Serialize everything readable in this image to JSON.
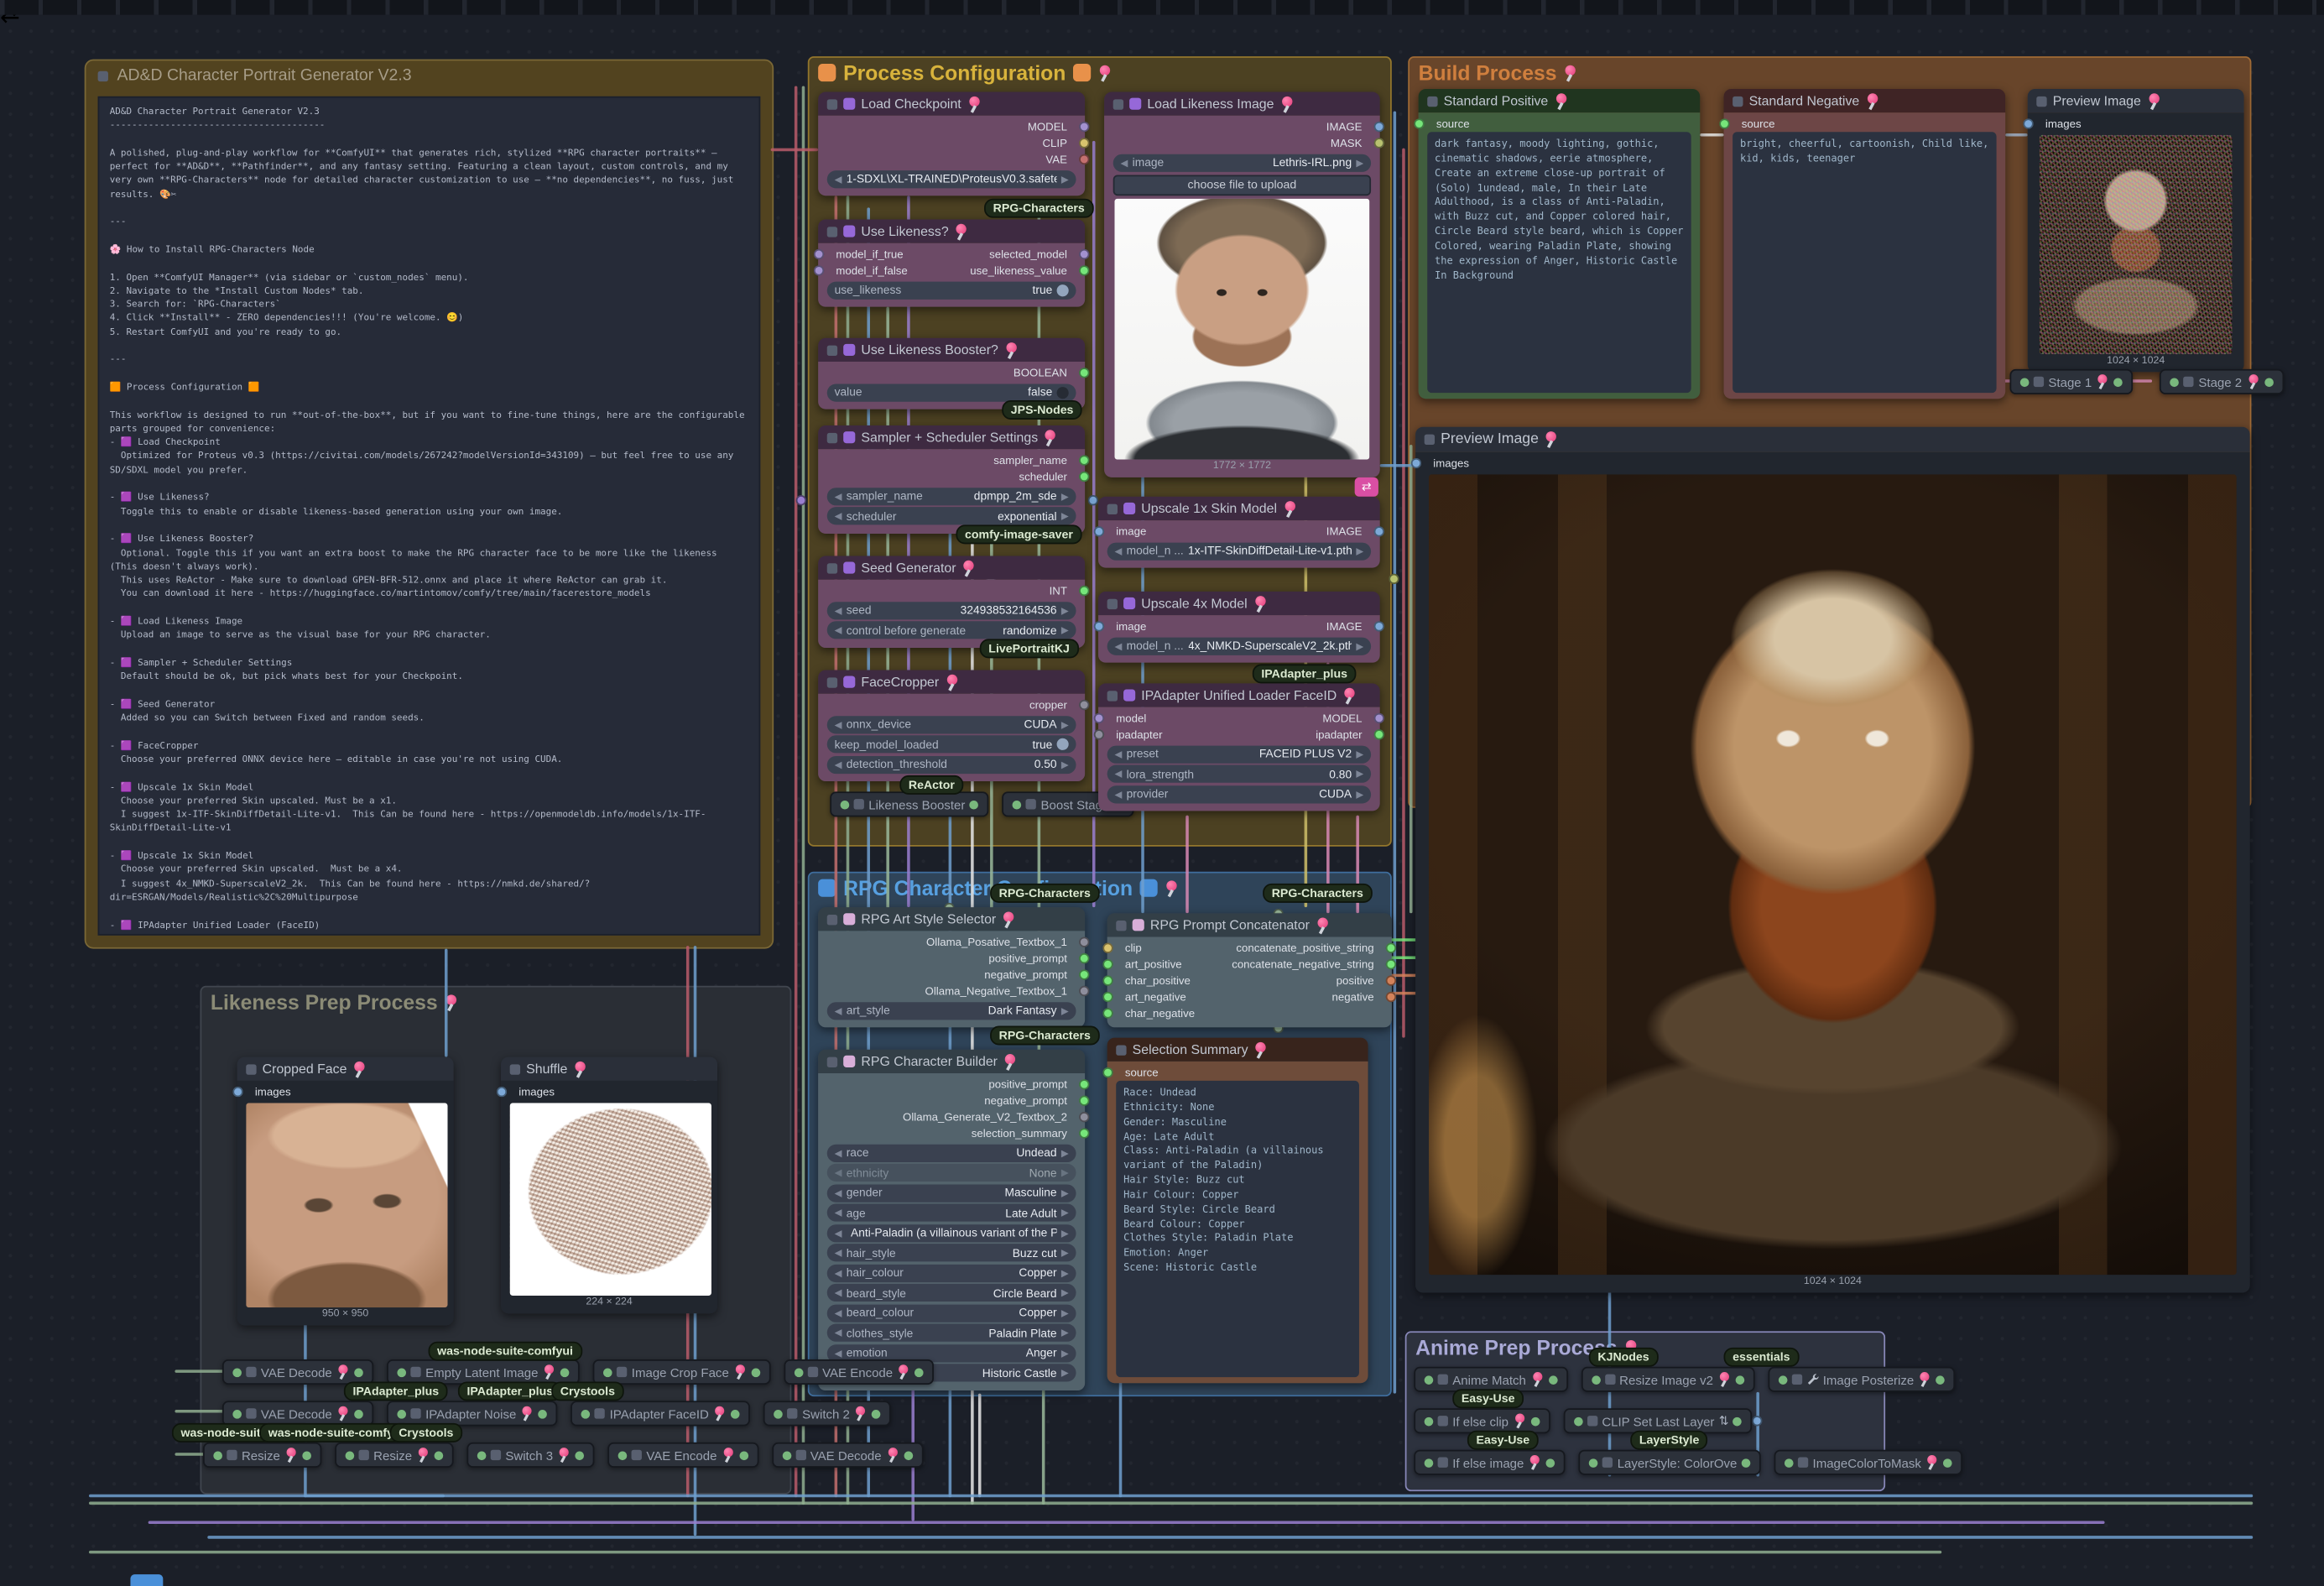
{
  "note": {
    "title": "AD&D Character Portrait Generator V2.3",
    "body": "AD&D Character Portrait Generator V2.3\n---------------------------------------\n\nA polished, plug-and-play workflow for **ComfyUI** that generates rich, stylized **RPG character portraits** — perfect for **AD&D**, **Pathfinder**, and any fantasy setting. Featuring a clean layout, custom controls, and my very own **RPG-Characters** node for detailed character customization to use — **no dependencies**, no fuss, just results. 🎨✂\n\n---\n\n🌸 How to Install RPG-Characters Node\n\n1. Open **ComfyUI Manager** (via sidebar or `custom_nodes` menu).\n2. Navigate to the *Install Custom Nodes* tab.\n3. Search for: `RPG-Characters`\n4. Click **Install** - ZERO dependencies!!! (You're welcome. 😊)\n5. Restart ComfyUI and you're ready to go.\n\n---\n\n🟧 Process Configuration 🟧\n\nThis workflow is designed to run **out-of-the-box**, but if you want to fine-tune things, here are the configurable parts grouped for convenience:\n- 🟪 Load Checkpoint\n  Optimized for Proteus v0.3 (https://civitai.com/models/267242?modelVersionId=343109) — but feel free to use any SD/SDXL model you prefer.\n\n- 🟪 Use Likeness?\n  Toggle this to enable or disable likeness-based generation using your own image.\n\n- 🟪 Use Likeness Booster?\n  Optional. Toggle this if you want an extra boost to make the RPG character face to be more like the likeness (This doesn't always work).\n  This uses ReActor - Make sure to download GPEN-BFR-512.onnx and place it where ReActor can grab it.\n  You can download it here - https://huggingface.co/martintomov/comfy/tree/main/facerestore_models\n\n- 🟪 Load Likeness Image\n  Upload an image to serve as the visual base for your RPG character.\n\n- 🟪 Sampler + Scheduler Settings\n  Default should be ok, but pick whats best for your Checkpoint.\n\n- 🟪 Seed Generator\n  Added so you can Switch between Fixed and random seeds.\n\n- 🟪 FaceCropper\n  Choose your preferred ONNX device here — editable in case you're not using CUDA.\n\n- 🟪 Upscale 1x Skin Model\n  Choose your preferred Skin upscaled. Must be a x1.\n  I suggest 1x-ITF-SkinDiffDetail-Lite-v1.  This Can be found here - https://openmodeldb.info/models/1x-ITF-SkinDiffDetail-Lite-v1\n\n- 🟪 Upscale 1x Skin Model\n  Choose your preferred Skin upscaled.  Must be a x4.\n  I suggest 4x_NMKD-SuperscaleV2_2k.  This Can be found here - https://nmkd.de/shared/?dir=ESRGAN/Models/Realistic%2C%20Multipurpose\n\n- 🟪 IPAdapter Unified Loader (FaceID)\n  Also editable so you can select your preferred backend provider.\n\n---\n\n🟦 RPG Character Configuration 🟦\n\nThis is where the *magic* happens — powered by **custom RPG nodes** made specifically for immersive character creation.\n\n- 🟪 RPG Art Style Selector\n  Pick the art style you want for your character: Anime, Realistic, Dark Fantasy, etc.\n\n- 🟪 RPG Character Builder\n  Customize Race, Gender, Age, Class, Hair, Clothing, Emotion, Scene, and more.\n\n---\n\n🚀 That's It!\n\nOnce you've tweaked your inputs (or left them at default), **just run the workflow** and enjoy your character portrait.\n\nHappy questing! 🎲🛡"
  },
  "badges": {
    "rpg": "RPG-Characters",
    "jps": "JPS-Nodes",
    "cis": "comfy-image-saver",
    "lp": "LivePortraitKJ",
    "reactor": "ReActor",
    "ipa": "IPAdapter_plus",
    "was": "was-node-suite-comfyui",
    "was_cut": "was-node-suite-comfy",
    "crys": "Crystools",
    "kj": "KJNodes",
    "ess": "essentials",
    "easy": "Easy-Use",
    "layer": "LayerStyle"
  },
  "process": {
    "title": "Process Configuration",
    "load_checkpoint": {
      "title": "Load Checkpoint",
      "outputs": [
        {
          "label": "MODEL",
          "color": "#a291cf"
        },
        {
          "label": "CLIP",
          "color": "#d9c36e"
        },
        {
          "label": "VAE",
          "color": "#c4706f"
        }
      ],
      "widget": {
        "value": "1-SDXL\\XL-TRAINED\\ProteusV0.3.safete ..."
      }
    },
    "use_likeness": {
      "title": "Use Likeness?",
      "inputs": [
        {
          "label": "model_if_true",
          "color": "#a291cf"
        },
        {
          "label": "model_if_false",
          "color": "#a291cf"
        }
      ],
      "outputs": [
        {
          "label": "selected_model",
          "color": "#a291cf"
        },
        {
          "label": "use_likeness_value",
          "color": "#76e67a"
        }
      ],
      "toggle": {
        "label": "use_likeness",
        "value": "true"
      }
    },
    "booster": {
      "title": "Use Likeness Booster?",
      "outputs": [
        {
          "label": "BOOLEAN",
          "color": "#76e67a"
        }
      ],
      "toggle": {
        "label": "value",
        "value": "false"
      }
    },
    "sampler": {
      "title": "Sampler + Scheduler Settings",
      "outputs": [
        {
          "label": "sampler_name",
          "color": "#76e67a"
        },
        {
          "label": "scheduler",
          "color": "#76e67a"
        }
      ],
      "widgets": [
        {
          "label": "sampler_name",
          "value": "dpmpp_2m_sde",
          "type": "combo"
        },
        {
          "label": "scheduler",
          "value": "exponential",
          "type": "combo"
        }
      ]
    },
    "seed": {
      "title": "Seed Generator",
      "outputs": [
        {
          "label": "INT",
          "color": "#76e67a"
        }
      ],
      "widgets": [
        {
          "label": "seed",
          "value": "324938532164536",
          "type": "combo"
        },
        {
          "label": "control before generate",
          "value": "randomize",
          "type": "combo"
        }
      ]
    },
    "facecropper": {
      "title": "FaceCropper",
      "outputs": [
        {
          "label": "cropper",
          "color": "#8e8e9c"
        }
      ],
      "widgets": [
        {
          "label": "onnx_device",
          "value": "CUDA",
          "type": "combo"
        },
        {
          "label": "keep_model_loaded",
          "value": "true",
          "type": "toggle-on"
        },
        {
          "label": "detection_threshold",
          "value": "0.50",
          "type": "combo"
        }
      ]
    },
    "collapsed": [
      {
        "label": "Likeness Booster"
      },
      {
        "label": "Boost Stage"
      }
    ],
    "load_image": {
      "title": "Load Likeness Image",
      "outputs": [
        {
          "label": "IMAGE",
          "color": "#7da9d8"
        },
        {
          "label": "MASK",
          "color": "#b9c270"
        }
      ],
      "widget": {
        "label": "image",
        "value": "Lethris-IRL.png"
      },
      "button": "choose file to upload",
      "caption": "1772 × 1772"
    },
    "upscale1": {
      "title": "Upscale 1x Skin Model",
      "inputs": [
        {
          "label": "image",
          "color": "#7da9d8"
        }
      ],
      "outputs": [
        {
          "label": "IMAGE",
          "color": "#7da9d8"
        }
      ],
      "widget": {
        "label": "model_n ...",
        "value": "1x-ITF-SkinDiffDetail-Lite-v1.pth"
      }
    },
    "upscale4": {
      "title": "Upscale 4x Model",
      "inputs": [
        {
          "label": "image",
          "color": "#7da9d8"
        }
      ],
      "outputs": [
        {
          "label": "IMAGE",
          "color": "#7da9d8"
        }
      ],
      "widget": {
        "label": "model_n ...",
        "value": "4x_NMKD-SuperscaleV2_2k.pth"
      }
    },
    "ipadapter": {
      "title": "IPAdapter Unified Loader FaceID",
      "inputs": [
        {
          "label": "model",
          "color": "#a291cf"
        },
        {
          "label": "ipadapter",
          "color": "#8e8e9c"
        }
      ],
      "outputs": [
        {
          "label": "MODEL",
          "color": "#a291cf"
        },
        {
          "label": "ipadapter",
          "color": "#76e67a"
        }
      ],
      "widgets": [
        {
          "label": "preset",
          "value": "FACEID PLUS V2",
          "type": "combo"
        },
        {
          "label": "lora_strength",
          "value": "0.80",
          "type": "combo"
        },
        {
          "label": "provider",
          "value": "CUDA",
          "type": "combo"
        }
      ]
    }
  },
  "build": {
    "title": "Build Process",
    "positive": {
      "title": "Standard Positive",
      "port": "source",
      "port_color": "#76e67a",
      "text": "dark fantasy, moody lighting, gothic, cinematic shadows, eerie atmosphere, Create an extreme close-up portrait of (Solo) 1undead, male, In their Late Adulthood, is a class of Anti-Paladin, with Buzz cut, and Copper colored hair, Circle Beard style beard, which is Copper Colored, wearing Paladin Plate, showing the expression of Anger, Historic Castle In Background"
    },
    "negative": {
      "title": "Standard Negative",
      "port": "source",
      "port_color": "#76e67a",
      "text": "bright, cheerful, cartoonish, Child like, kid, kids, teenager"
    },
    "preview_small": {
      "title": "Preview Image",
      "port": "images",
      "port_color": "#7da9d8",
      "caption": "1024 × 1024"
    },
    "stages": [
      {
        "label": "Stage 1",
        "cls": "haspin"
      },
      {
        "label": "Stage 2",
        "cls": "haspin"
      }
    ]
  },
  "preview_big": {
    "title": "Preview Image",
    "port": "images",
    "port_color": "#7da9d8",
    "caption": "1024 × 1024"
  },
  "rpg": {
    "title": "RPG Character Configuration",
    "art_selector": {
      "title": "RPG Art Style Selector",
      "outputs": [
        {
          "label": "Ollama_Posative_Textbox_1",
          "color": "#8e8e9c"
        },
        {
          "label": "positive_prompt",
          "color": "#76e67a"
        },
        {
          "label": "negative_prompt",
          "color": "#76e67a"
        },
        {
          "label": "Ollama_Negative_Textbox_1",
          "color": "#8e8e9c"
        }
      ],
      "widget": {
        "label": "art_style",
        "value": "Dark Fantasy"
      }
    },
    "builder": {
      "title": "RPG Character Builder",
      "outputs": [
        {
          "label": "positive_prompt",
          "color": "#76e67a"
        },
        {
          "label": "negative_prompt",
          "color": "#76e67a"
        },
        {
          "label": "Ollama_Generate_V2_Textbox_2",
          "color": "#8e8e9c"
        },
        {
          "label": "selection_summary",
          "color": "#76e67a"
        }
      ],
      "widgets": [
        {
          "label": "race",
          "value": "Undead",
          "type": "combo"
        },
        {
          "label": "ethnicity",
          "value": "None",
          "type": "combo dim"
        },
        {
          "label": "gender",
          "value": "Masculine",
          "type": "combo"
        },
        {
          "label": "age",
          "value": "Late Adult",
          "type": "combo"
        },
        {
          "label": "",
          "value": "Anti-Paladin (a villainous variant of the Pala ...",
          "type": "combo long"
        },
        {
          "label": "hair_style",
          "value": "Buzz cut",
          "type": "combo"
        },
        {
          "label": "hair_colour",
          "value": "Copper",
          "type": "combo"
        },
        {
          "label": "beard_style",
          "value": "Circle Beard",
          "type": "combo"
        },
        {
          "label": "beard_colour",
          "value": "Copper",
          "type": "combo"
        },
        {
          "label": "clothes_style",
          "value": "Paladin Plate",
          "type": "combo"
        },
        {
          "label": "emotion",
          "value": "Anger",
          "type": "combo"
        },
        {
          "label": "scene",
          "value": "Historic Castle",
          "type": "combo"
        }
      ]
    },
    "concat": {
      "title": "RPG Prompt Concatenator",
      "inputs": [
        {
          "label": "clip",
          "color": "#d9c36e"
        },
        {
          "label": "art_positive",
          "color": "#76e67a"
        },
        {
          "label": "char_positive",
          "color": "#76e67a"
        },
        {
          "label": "art_negative",
          "color": "#76e67a"
        },
        {
          "label": "char_negative",
          "color": "#76e67a"
        }
      ],
      "outputs": [
        {
          "label": "concatenate_positive_string",
          "color": "#76e67a"
        },
        {
          "label": "concatenate_negative_string",
          "color": "#76e67a"
        },
        {
          "label": "positive",
          "color": "#d3825a"
        },
        {
          "label": "negative",
          "color": "#d3825a"
        }
      ]
    },
    "summary": {
      "title": "Selection Summary",
      "port": "source",
      "port_color": "#76e67a",
      "text": "Race: Undead\nEthnicity: None\nGender: Masculine\nAge: Late Adult\nClass: Anti-Paladin (a villainous variant of the Paladin)\nHair Style: Buzz cut\nHair Colour: Copper\nBeard Style: Circle Beard\nBeard Colour: Copper\nClothes Style: Paladin Plate\nEmotion: Anger\nScene: Historic Castle"
    }
  },
  "likeness": {
    "title": "Likeness Prep Process",
    "cropped": {
      "title": "Cropped Face",
      "port": "images",
      "port_color": "#7da9d8",
      "caption": "950 × 950"
    },
    "shuffle": {
      "title": "Shuffle",
      "port": "images",
      "port_color": "#7da9d8",
      "caption": "224 × 224"
    },
    "row1": [
      {
        "label": "VAE Decode",
        "cls": "haspin"
      },
      {
        "label": "Empty Latent Image",
        "cls": "haspin"
      },
      {
        "label": "Image Crop Face",
        "cls": "haspin"
      },
      {
        "label": "VAE Encode",
        "cls": "haspin"
      }
    ],
    "row2": [
      {
        "label": "VAE Decode",
        "cls": "haspin"
      },
      {
        "label": "IPAdapter Noise",
        "cls": "haspin"
      },
      {
        "label": "IPAdapter FaceID",
        "cls": "haspin"
      },
      {
        "label": "Switch 2",
        "cls": "haspin"
      }
    ],
    "row3": [
      {
        "label": "Resize",
        "cls": "haspin"
      },
      {
        "label": "Resize",
        "cls": "haspin"
      },
      {
        "label": "Switch 3",
        "cls": "haspin"
      },
      {
        "label": "VAE Encode",
        "cls": "haspin"
      },
      {
        "label": "VAE Decode",
        "cls": "haspin"
      }
    ]
  },
  "anime": {
    "title": "Anime Prep Process",
    "row1": [
      {
        "label": "Anime Match",
        "cls": "haspin"
      },
      {
        "label": "Resize Image v2",
        "cls": "haspin"
      },
      {
        "label": "Image Posterize",
        "cls": "haspin wrench"
      }
    ],
    "row2": [
      {
        "label": "If else clip",
        "cls": "haspin"
      },
      {
        "label": "CLIP Set Last Layer",
        "cls": "tail"
      }
    ],
    "row3": [
      {
        "label": "If else image",
        "cls": "haspin"
      },
      {
        "label": "LayerStyle: ColorOve",
        "cls": ""
      },
      {
        "label": "ImageColorToMask",
        "cls": "haspin"
      }
    ]
  },
  "misc": {
    "reroute_icon": "⇄"
  }
}
